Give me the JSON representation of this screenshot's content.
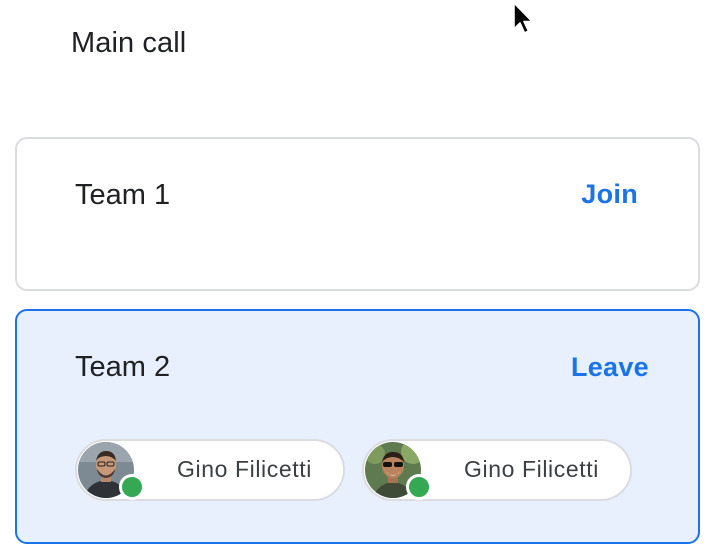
{
  "main_call": {
    "label": "Main call"
  },
  "teams": [
    {
      "name": "Team 1",
      "action": "Join",
      "members": []
    },
    {
      "name": "Team 2",
      "action": "Leave",
      "members": [
        {
          "name": "Gino Filicetti",
          "status": "online"
        },
        {
          "name": "Gino Filicetti",
          "status": "online"
        }
      ]
    }
  ],
  "colors": {
    "accent": "#1a73e8",
    "selected_card_bg": "#e8f0fe",
    "card_border": "#dadce0",
    "presence_online": "#34a853",
    "text_primary": "#202124"
  },
  "icons": {
    "cursor": "mouse-pointer-icon",
    "presence": "online-status-dot-icon"
  }
}
